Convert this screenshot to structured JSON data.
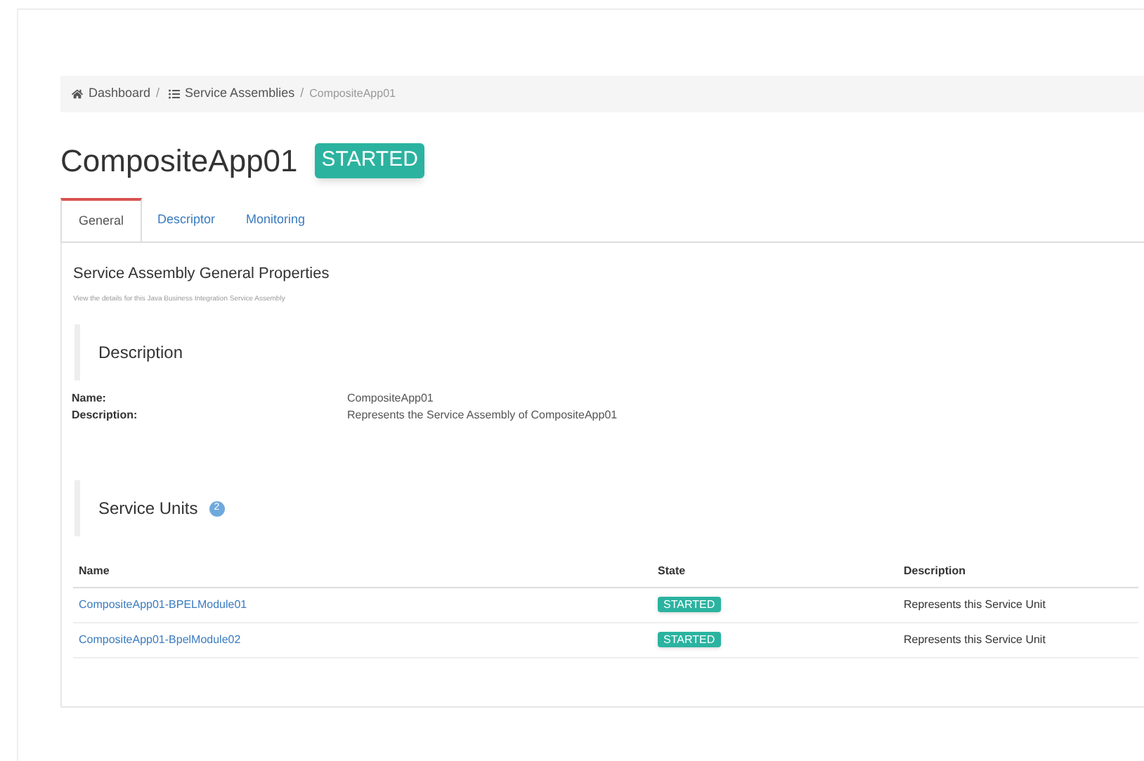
{
  "breadcrumb": [
    {
      "label": "Dashboard",
      "kind": "home",
      "separator": "/"
    },
    {
      "label": "Service Assemblies",
      "kind": "list",
      "separator": "/"
    },
    {
      "label": "CompositeApp01",
      "kind": "current"
    }
  ],
  "title": "CompositeApp01",
  "status": "STARTED",
  "tabs": [
    {
      "label": "General",
      "selected": true
    },
    {
      "label": "Descriptor",
      "selected": false
    },
    {
      "label": "Monitoring",
      "selected": false
    }
  ],
  "section_title": "Service Assembly General Properties",
  "section_subtitle": "View the details for this Java Business Integration Service Assembly",
  "description": {
    "heading": "Description",
    "properties": [
      {
        "label": "Name:",
        "value": "CompositeApp01"
      },
      {
        "label": "Description:",
        "value": "Represents the Service Assembly of CompositeApp01"
      }
    ]
  },
  "service_units": {
    "heading": "Service Units",
    "count": "2",
    "columns": [
      "Name",
      "State",
      "Description"
    ],
    "rows": [
      {
        "name": "CompositeApp01-BPELModule01",
        "state": "STARTED",
        "description": "Represents this Service Unit"
      },
      {
        "name": "CompositeApp01-BpelModule02",
        "state": "STARTED",
        "description": "Represents this Service Unit"
      }
    ]
  }
}
